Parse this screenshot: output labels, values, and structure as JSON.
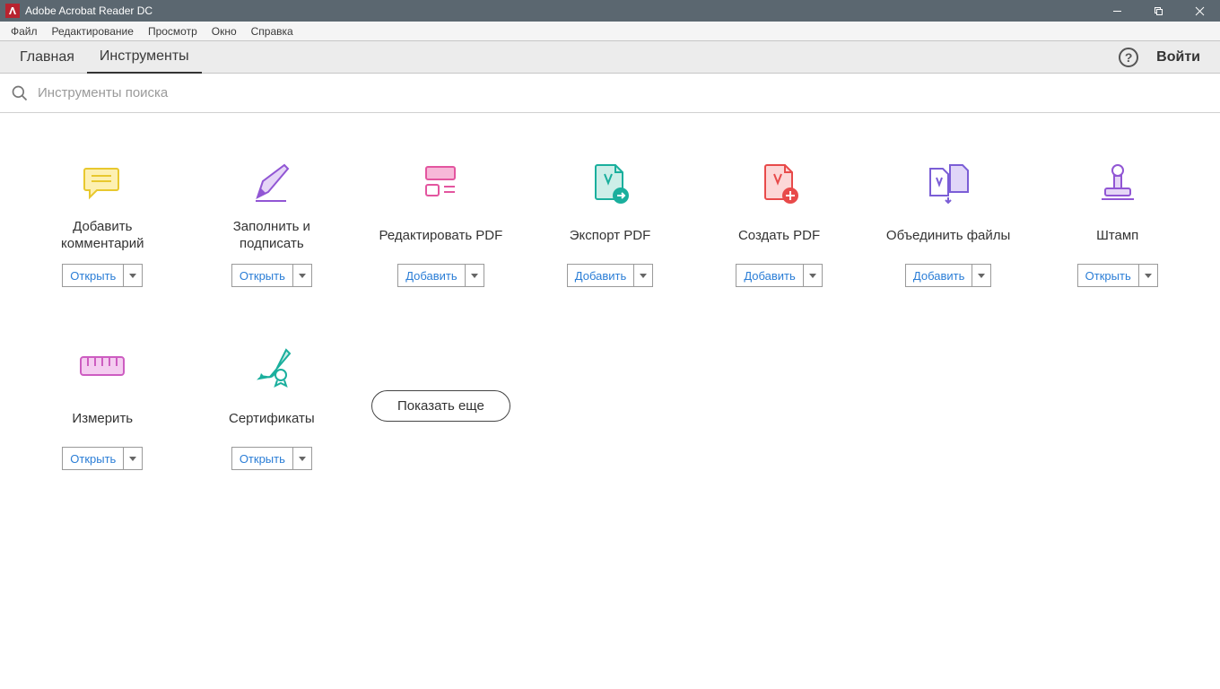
{
  "titlebar": {
    "title": "Adobe Acrobat Reader DC"
  },
  "menubar": {
    "items": [
      "Файл",
      "Редактирование",
      "Просмотр",
      "Окно",
      "Справка"
    ]
  },
  "tabs": {
    "items": [
      "Главная",
      "Инструменты"
    ],
    "activeIndex": 1
  },
  "header": {
    "signin": "Войти",
    "help": "?"
  },
  "search": {
    "placeholder": "Инструменты поиска"
  },
  "buttons": {
    "open": "Открыть",
    "add": "Добавить"
  },
  "tools_row1": [
    {
      "name": "add-comment",
      "label": "Добавить\nкомментарий",
      "button": "open"
    },
    {
      "name": "fill-sign",
      "label": "Заполнить и\nподписать",
      "button": "open"
    },
    {
      "name": "edit-pdf",
      "label": "Редактировать PDF",
      "button": "add"
    },
    {
      "name": "export-pdf",
      "label": "Экспорт PDF",
      "button": "add"
    },
    {
      "name": "create-pdf",
      "label": "Создать PDF",
      "button": "add"
    },
    {
      "name": "combine-files",
      "label": "Объединить файлы",
      "button": "add"
    },
    {
      "name": "stamp",
      "label": "Штамп",
      "button": "open"
    }
  ],
  "tools_row2": [
    {
      "name": "measure",
      "label": "Измерить",
      "button": "open"
    },
    {
      "name": "certificates",
      "label": "Сертификаты",
      "button": "open"
    }
  ],
  "show_more": "Показать еще"
}
